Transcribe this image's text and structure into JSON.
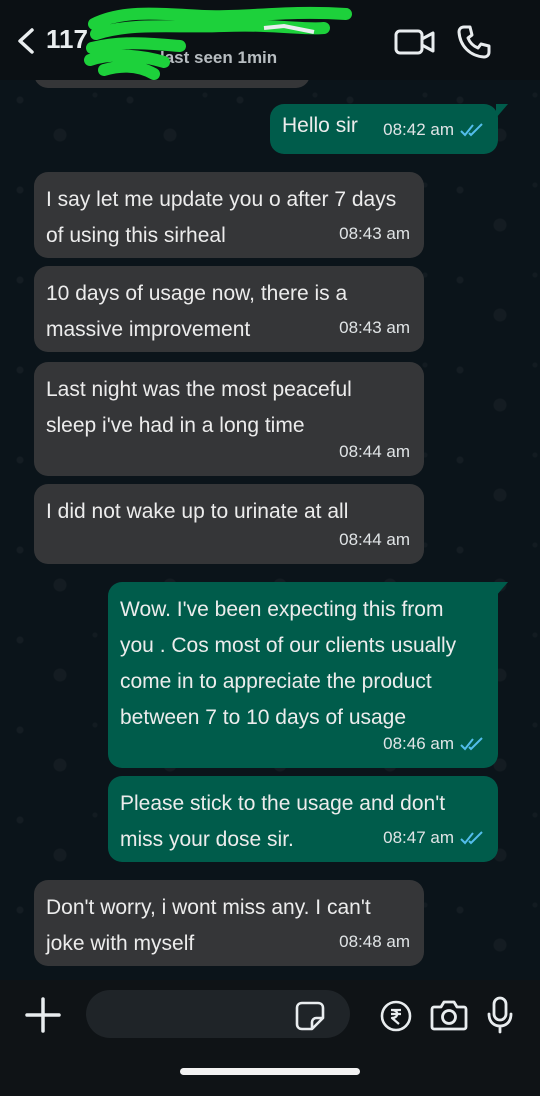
{
  "header": {
    "contact_name": "117",
    "last_seen": "last seen 1min"
  },
  "messages": [
    {
      "direction": "out",
      "text": "Hello sir",
      "time": "08:42 am",
      "status": "read"
    },
    {
      "direction": "in",
      "text": "I say let me update you o after 7 days of using this sirheal",
      "time": "08:43 am"
    },
    {
      "direction": "in",
      "text": "10 days of usage now, there is a massive improvement",
      "time": "08:43 am"
    },
    {
      "direction": "in",
      "text": "Last night was the most peaceful sleep i've had in a long time",
      "time": "08:44 am"
    },
    {
      "direction": "in",
      "text": "I did not wake up to urinate at all",
      "time": "08:44 am"
    },
    {
      "direction": "out",
      "text": "Wow. I've been expecting this from you . Cos most of our clients usually come in to appreciate the product between 7 to 10 days of usage",
      "time": "08:46 am",
      "status": "read"
    },
    {
      "direction": "out",
      "text": "Please stick to the usage and don't miss your dose sir.",
      "time": "08:47 am",
      "status": "read"
    },
    {
      "direction": "in",
      "text": "Don't worry, i wont miss any. I can't joke with myself",
      "time": "08:48 am"
    }
  ],
  "composer": {
    "placeholder": ""
  },
  "colors": {
    "outgoing_bubble": "#005c4b",
    "incoming_bubble": "#353638",
    "read_tick": "#53bdeb",
    "background": "#0b141a"
  },
  "icons": [
    "back-arrow-icon",
    "video-call-icon",
    "phone-icon",
    "plus-icon",
    "sticker-icon",
    "rupee-icon",
    "camera-icon",
    "mic-icon"
  ]
}
